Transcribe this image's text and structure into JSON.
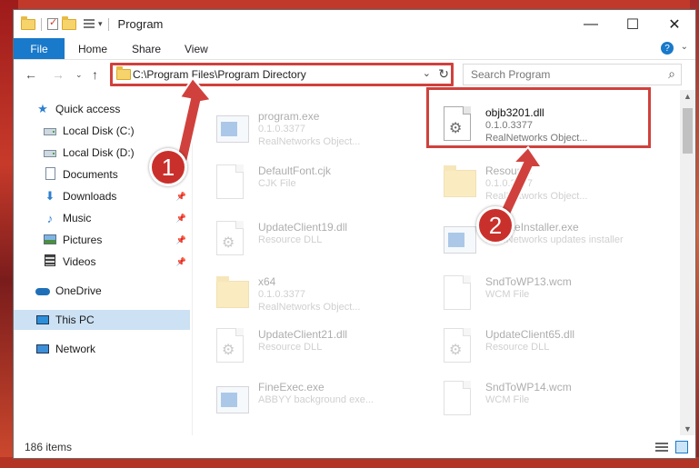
{
  "window": {
    "title": "Program",
    "controls": {
      "minimize": "—",
      "maximize": "☐",
      "close": "✕"
    }
  },
  "ribbon": {
    "tabs": [
      "File",
      "Home",
      "Share",
      "View"
    ],
    "help": "?",
    "expand": "⌄"
  },
  "address": {
    "path": "C:\\Program Files\\Program Directory",
    "dropdown": "⌄",
    "refresh": "↻"
  },
  "nav_buttons": {
    "back": "←",
    "forward": "→",
    "recent": "⌄",
    "up": "↑"
  },
  "search": {
    "placeholder": "Search Program",
    "icon": "⌕"
  },
  "sidebar": {
    "items": [
      {
        "label": "Quick access",
        "icon": "star-icon"
      },
      {
        "label": "Local Disk (C:)",
        "icon": "disk-icon"
      },
      {
        "label": "Local Disk (D:)",
        "icon": "disk-icon"
      },
      {
        "label": "Documents",
        "icon": "document-icon"
      },
      {
        "label": "Downloads",
        "icon": "download-icon",
        "pinned": true
      },
      {
        "label": "Music",
        "icon": "music-icon",
        "pinned": true
      },
      {
        "label": "Pictures",
        "icon": "pictures-icon",
        "pinned": true
      },
      {
        "label": "Videos",
        "icon": "videos-icon",
        "pinned": true
      },
      {
        "label": "OneDrive",
        "icon": "cloud-icon"
      },
      {
        "label": "This PC",
        "icon": "computer-icon",
        "selected": true
      },
      {
        "label": "Network",
        "icon": "network-icon"
      }
    ],
    "pin_glyph": "📌"
  },
  "files": [
    {
      "name": "program.exe",
      "line2": "0.1.0.3377",
      "line3": "RealNetworks Object...",
      "type": "exe"
    },
    {
      "name": "objb3201.dll",
      "line2": "0.1.0.3377",
      "line3": "RealNetworks Object...",
      "type": "dll",
      "highlighted": true
    },
    {
      "name": "DefaultFont.cjk",
      "line2": "CJK File",
      "line3": "",
      "type": "page"
    },
    {
      "name": "Resource",
      "line2": "0.1.0.3377",
      "line3": "RealNetworks Object...",
      "type": "folder"
    },
    {
      "name": "UpdateClient19.dll",
      "line2": "Resource DLL",
      "line3": "",
      "type": "dll"
    },
    {
      "name": "UpdateInstaller.exe",
      "line2": "RealNetworks updates installer",
      "line3": "",
      "type": "exe"
    },
    {
      "name": "x64",
      "line2": "0.1.0.3377",
      "line3": "RealNetworks Object...",
      "type": "folder"
    },
    {
      "name": "SndToWP13.wcm",
      "line2": "WCM File",
      "line3": "",
      "type": "page"
    },
    {
      "name": "UpdateClient21.dll",
      "line2": "Resource DLL",
      "line3": "",
      "type": "dll"
    },
    {
      "name": "UpdateClient65.dll",
      "line2": "Resource DLL",
      "line3": "",
      "type": "dll"
    },
    {
      "name": "FineExec.exe",
      "line2": "ABBYY background exe...",
      "line3": "",
      "type": "exe"
    },
    {
      "name": "SndToWP14.wcm",
      "line2": "WCM File",
      "line3": "",
      "type": "page"
    }
  ],
  "status": {
    "item_count": "186 items"
  },
  "annotations": {
    "step1": "1",
    "step2": "2",
    "color": "#d0413d"
  }
}
